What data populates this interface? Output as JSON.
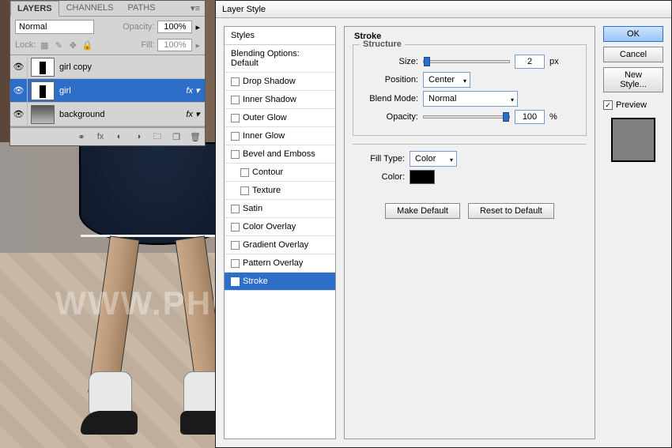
{
  "watermark": "WWW.PHOTOSHOPSUPPLY.COM",
  "layersPanel": {
    "tabs": [
      "LAYERS",
      "CHANNELS",
      "PATHS"
    ],
    "activeTab": 0,
    "blendMode": "Normal",
    "opacityLabel": "Opacity:",
    "opacityValue": "100%",
    "lockLabel": "Lock:",
    "fillLabel": "Fill:",
    "fillValue": "100%",
    "layers": [
      {
        "name": "girl copy",
        "visible": true,
        "selected": false,
        "fx": false,
        "thumb": "girl"
      },
      {
        "name": "girl",
        "visible": true,
        "selected": true,
        "fx": true,
        "thumb": "girl"
      },
      {
        "name": "background",
        "visible": true,
        "selected": false,
        "fx": true,
        "thumb": "bg"
      }
    ]
  },
  "dialog": {
    "title": "Layer Style",
    "stylesHead": "Styles",
    "blendingDefault": "Blending Options: Default",
    "items": [
      {
        "label": "Drop Shadow",
        "checked": false,
        "indent": false
      },
      {
        "label": "Inner Shadow",
        "checked": false,
        "indent": false
      },
      {
        "label": "Outer Glow",
        "checked": false,
        "indent": false
      },
      {
        "label": "Inner Glow",
        "checked": false,
        "indent": false
      },
      {
        "label": "Bevel and Emboss",
        "checked": false,
        "indent": false
      },
      {
        "label": "Contour",
        "checked": false,
        "indent": true
      },
      {
        "label": "Texture",
        "checked": false,
        "indent": true
      },
      {
        "label": "Satin",
        "checked": false,
        "indent": false
      },
      {
        "label": "Color Overlay",
        "checked": false,
        "indent": false
      },
      {
        "label": "Gradient Overlay",
        "checked": false,
        "indent": false
      },
      {
        "label": "Pattern Overlay",
        "checked": false,
        "indent": false
      },
      {
        "label": "Stroke",
        "checked": true,
        "indent": false,
        "selected": true
      }
    ],
    "main": {
      "heading": "Stroke",
      "structure": "Structure",
      "sizeLabel": "Size:",
      "sizeValue": "2",
      "sizeUnit": "px",
      "positionLabel": "Position:",
      "positionValue": "Center",
      "blendLabel": "Blend Mode:",
      "blendValue": "Normal",
      "opacityLabel": "Opacity:",
      "opacityValue": "100",
      "opacityUnit": "%",
      "fillTypeLabel": "Fill Type:",
      "fillTypeValue": "Color",
      "colorLabel": "Color:",
      "colorValue": "#000000",
      "makeDefault": "Make Default",
      "resetDefault": "Reset to Default"
    },
    "right": {
      "ok": "OK",
      "cancel": "Cancel",
      "newStyle": "New Style...",
      "preview": "Preview"
    }
  }
}
